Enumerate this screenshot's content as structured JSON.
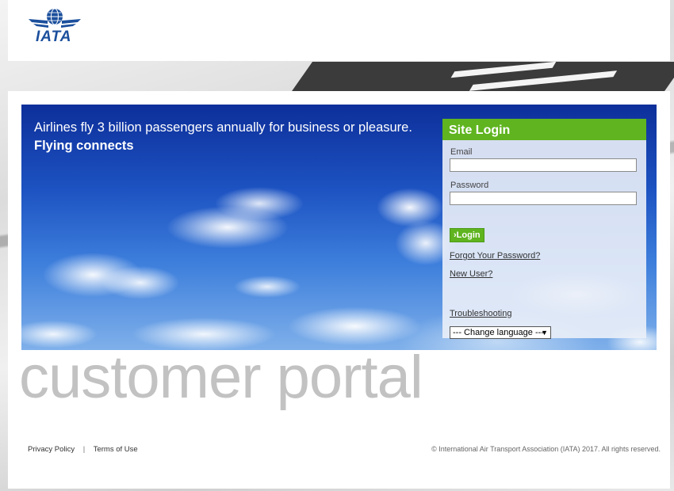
{
  "header": {
    "logo_text": "IATA"
  },
  "hero": {
    "line1": "Airlines fly 3 billion passengers annually for business or pleasure.",
    "line2": "Flying connects"
  },
  "login": {
    "title": "Site Login",
    "email_label": "Email",
    "email_value": "",
    "password_label": "Password",
    "password_value": "",
    "login_button": "›Login",
    "forgot_password": "Forgot Your Password?",
    "new_user": "New User?",
    "troubleshooting": "Troubleshooting",
    "language_select": "--- Change language ---"
  },
  "portal_title": "customer portal",
  "footer": {
    "privacy": "Privacy Policy",
    "separator": "|",
    "terms": "Terms of Use",
    "copyright": "© International Air Transport Association (IATA) 2017. All rights reserved."
  },
  "colors": {
    "accent_green": "#5fb41f",
    "logo_blue": "#1b4f9c",
    "sky_blue": "#1d53c2"
  },
  "icons": {
    "logo": "iata-globe-wings-icon",
    "dropdown": "caret-down-icon"
  }
}
